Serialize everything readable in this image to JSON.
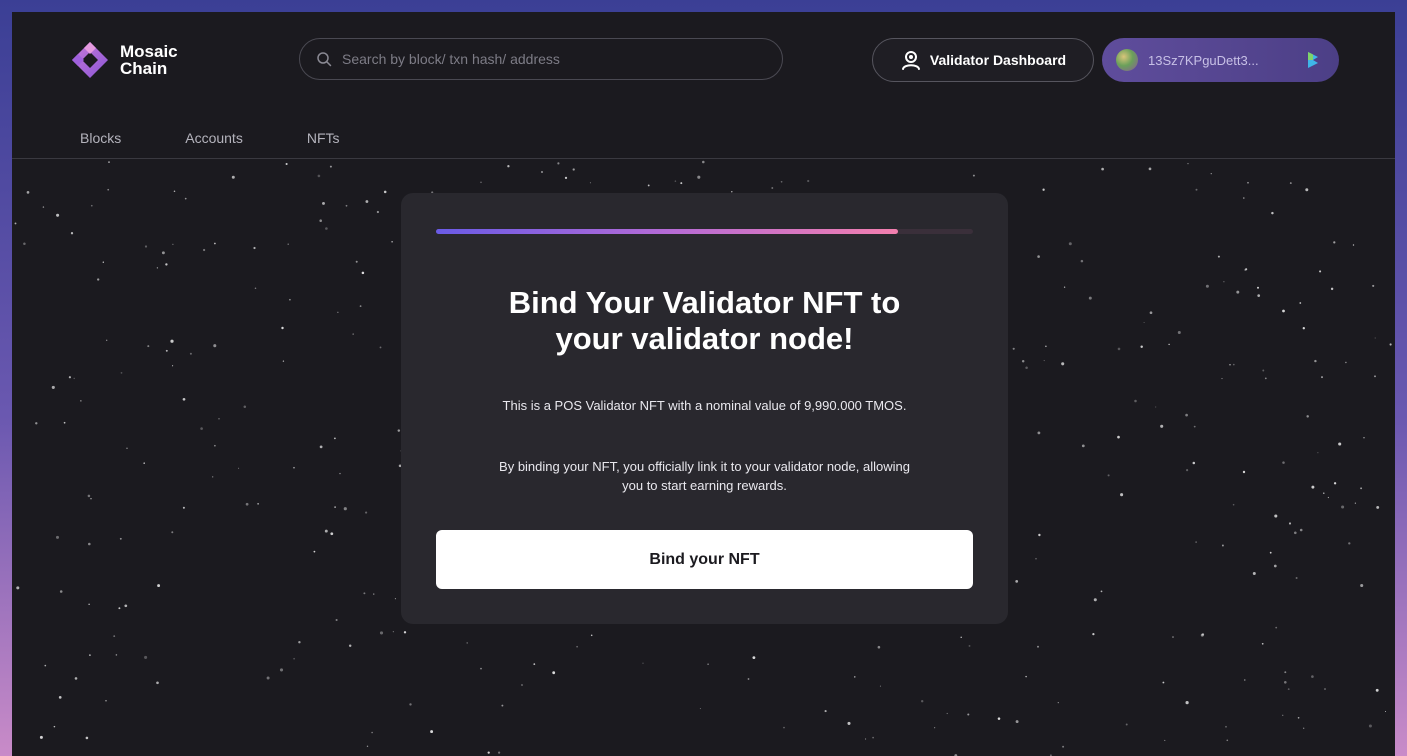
{
  "brand": {
    "logo_line1": "Mosaic",
    "logo_line2": "Chain",
    "logo_icon": "mosaic-diamond-logo"
  },
  "header": {
    "search": {
      "placeholder": "Search by block/ txn hash/ address",
      "value": "",
      "icon": "search-icon"
    },
    "validator_dashboard": {
      "label": "Validator Dashboard",
      "icon": "validator-user-icon"
    },
    "wallet": {
      "address": "13Sz7KPguDett3...",
      "icon": "wallet-token-icon"
    }
  },
  "nav": {
    "items": [
      {
        "label": "Blocks"
      },
      {
        "label": "Accounts"
      },
      {
        "label": "NFTs"
      }
    ]
  },
  "card": {
    "progress_percent": 86,
    "title_line1": "Bind Your Validator NFT to",
    "title_line2": "your validator node!",
    "paragraph1": "This is a POS Validator NFT with a nominal value of 9,990.000 TMOS.",
    "paragraph2_line1": "By binding your NFT, you officially link it to your validator node, allowing",
    "paragraph2_line2": "you to start earning rewards.",
    "button_label": "Bind your NFT"
  },
  "colors": {
    "background": "#1b1a1f",
    "card": "#29282e",
    "accent_purple": "#6a5be6",
    "accent_pink": "#f37fae",
    "wallet_pill": "#5f4d9c"
  }
}
